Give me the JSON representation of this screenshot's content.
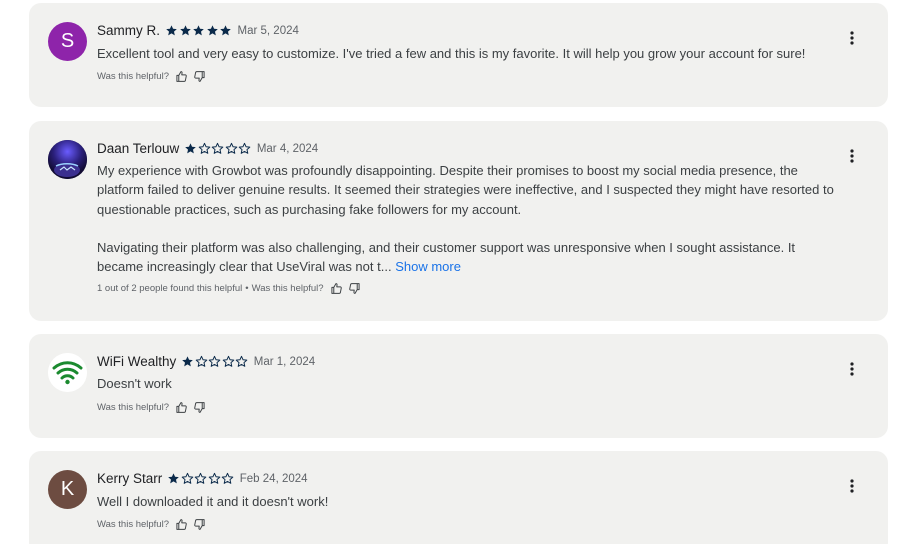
{
  "reviews": [
    {
      "author": "Sammy R.",
      "avatar_letter": "S",
      "avatar_color": "#8e24aa",
      "rating": 5,
      "date": "Mar 5, 2024",
      "text": "Excellent tool and very easy to customize. I've tried a few and this is my favorite. It will help you grow your account for sure!",
      "helpful_prompt": "Was this helpful?"
    },
    {
      "author": "Daan Terlouw",
      "avatar_icon": "profile-photo",
      "rating": 1,
      "date": "Mar 4, 2024",
      "text_p1": "My experience with Growbot was profoundly disappointing. Despite their promises to boost my social media presence, the platform failed to deliver genuine results. It seemed their strategies were ineffective, and I suspected they might have resorted to questionable practices, such as purchasing fake followers for my account.",
      "text_p2": "Navigating their platform was also challenging, and their customer support was unresponsive when I sought assistance. It became increasingly clear that UseViral was not t...",
      "show_more": "Show more",
      "helpful_count": "1 out of 2 people found this helpful",
      "helpful_prompt": "Was this helpful?"
    },
    {
      "author": "WiFi Wealthy",
      "avatar_icon": "wifi-logo",
      "rating": 1,
      "date": "Mar 1, 2024",
      "text": "Doesn't work",
      "helpful_prompt": "Was this helpful?"
    },
    {
      "author": "Kerry Starr",
      "avatar_letter": "K",
      "avatar_color": "#6d4c41",
      "rating": 1,
      "date": "Feb 24, 2024",
      "text": "Well I downloaded it and it doesn't work!",
      "helpful_prompt": "Was this helpful?"
    }
  ],
  "ui": {
    "separator": "•",
    "star_color": "#0b2a4a",
    "card_color": "#f1f1ef",
    "link_color": "#1a73e8"
  }
}
